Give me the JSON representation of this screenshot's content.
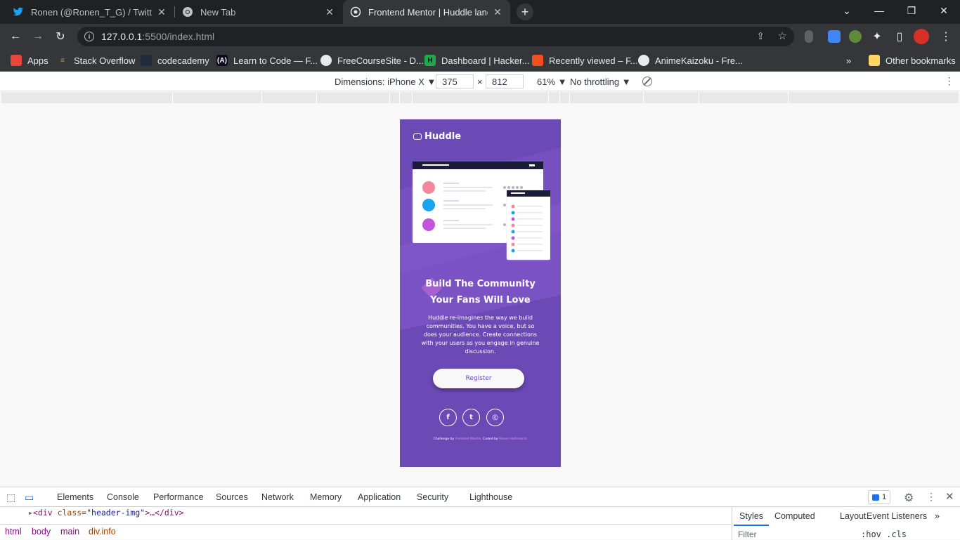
{
  "browser": {
    "tabs": [
      {
        "title": "Ronen (@Ronen_T_G) / Twitter",
        "icon": "twitter-icon",
        "active": false
      },
      {
        "title": "New Tab",
        "icon": "chrome-icon",
        "active": false
      },
      {
        "title": "Frontend Mentor | Huddle landin",
        "icon": "globe-icon",
        "active": true
      }
    ],
    "address": {
      "host": "127.0.0.1",
      "path": ":5500/index.html"
    },
    "bookmarks": [
      {
        "label": "Apps",
        "icon": "apps-grid-icon"
      },
      {
        "label": "Stack Overflow",
        "icon": "stackoverflow-icon"
      },
      {
        "label": "codecademy",
        "icon": "codecademy-icon"
      },
      {
        "label": "Learn to Code — F...",
        "icon": "freecodecamp-icon"
      },
      {
        "label": "FreeCourseSite - D...",
        "icon": "globe-icon"
      },
      {
        "label": "Dashboard | Hacker...",
        "icon": "hackerrank-icon"
      },
      {
        "label": "Recently viewed – F...",
        "icon": "figma-icon"
      },
      {
        "label": "AnimeKaizoku - Fre...",
        "icon": "anime-icon"
      }
    ],
    "bookmarks_overflow": "»",
    "other_bookmarks": "Other bookmarks"
  },
  "device_toolbar": {
    "dimensions_label": "Dimensions: iPhone X ▼",
    "width": "375",
    "times": "×",
    "height": "812",
    "zoom": "61% ▼",
    "throttling": "No throttling ▼"
  },
  "page": {
    "logo": "Huddle",
    "title_line1": "Build The Community",
    "title_line2": "Your Fans Will Love",
    "description": "Huddle re-imagines the way we build communities. You have a voice, but so does your audience. Create connections with your users as you engage in genuine discussion.",
    "register": "Register",
    "socials": [
      {
        "icon": "facebook-icon",
        "glyph": "f"
      },
      {
        "icon": "twitter-icon",
        "glyph": "t"
      },
      {
        "icon": "instagram-icon",
        "glyph": "◎"
      }
    ],
    "attribution": {
      "prefix": "Challenge by ",
      "link1": "Frontend Mentor",
      "middle": ". Coded by ",
      "link2": "Ronen Hammond",
      "suffix": "."
    },
    "colors": {
      "background": "#6c4ab6",
      "button_text": "#6c4ab6",
      "link": "#e78ff1"
    }
  },
  "devtools": {
    "tabs": [
      "Elements",
      "Console",
      "Performance",
      "Sources",
      "Network",
      "Memory",
      "Application",
      "Security",
      "Lighthouse"
    ],
    "message_count": "1",
    "code_tag_open": "<div ",
    "code_attr": "class=",
    "code_val": "\"header-img\"",
    "code_rest": ">…</div>",
    "breadcrumbs": [
      "html",
      "body",
      "main",
      "div.info"
    ],
    "side_tabs": [
      "Styles",
      "Computed",
      "Layout",
      "Event Listeners"
    ],
    "side_more": "»",
    "filter_placeholder": "Filter",
    "hov_cls": ":hov  .cls"
  }
}
